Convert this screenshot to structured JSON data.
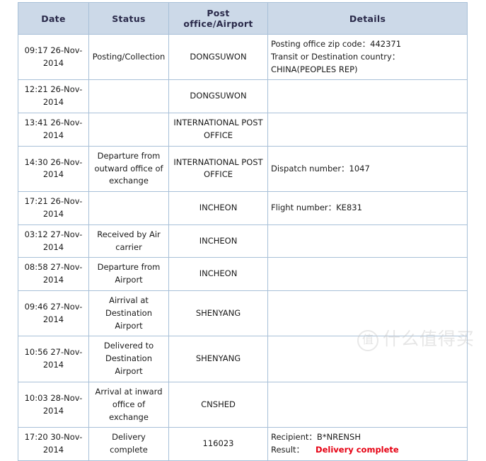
{
  "table": {
    "columns": [
      {
        "key": "date",
        "label": "Date"
      },
      {
        "key": "status",
        "label": "Status"
      },
      {
        "key": "office",
        "label": "Post office/Airport"
      },
      {
        "key": "detail",
        "label": "Details"
      }
    ],
    "rows": [
      {
        "date": "09:17 26-Nov-2014",
        "status": "Posting/Collection",
        "office": "DONGSUWON",
        "details": [
          "Posting office zip code：442371",
          "Transit or Destination country：",
          "CHINA(PEOPLES REP)"
        ]
      },
      {
        "date": "12:21 26-Nov-2014",
        "status": "",
        "office": "DONGSUWON",
        "details": []
      },
      {
        "date": "13:41 26-Nov-2014",
        "status": "",
        "office": "INTERNATIONAL POST OFFICE",
        "details": []
      },
      {
        "date": "14:30 26-Nov-2014",
        "status": "Departure from outward office of exchange",
        "office": "INTERNATIONAL POST OFFICE",
        "details": [
          "Dispatch number：1047"
        ]
      },
      {
        "date": "17:21 26-Nov-2014",
        "status": "",
        "office": "INCHEON",
        "details": [
          "Flight number：KE831"
        ]
      },
      {
        "date": "03:12 27-Nov-2014",
        "status": "Received by Air carrier",
        "office": "INCHEON",
        "details": []
      },
      {
        "date": "08:58 27-Nov-2014",
        "status": "Departure from Airport",
        "office": "INCHEON",
        "details": []
      },
      {
        "date": "09:46 27-Nov-2014",
        "status": "Airrival at Destination Airport",
        "office": "SHENYANG",
        "details": []
      },
      {
        "date": "10:56 27-Nov-2014",
        "status": "Delivered to Destination Airport",
        "office": "SHENYANG",
        "details": []
      },
      {
        "date": "10:03 28-Nov-2014",
        "status": "Arrival at inward office of exchange",
        "office": "CNSHED",
        "details": []
      },
      {
        "date": "17:20 30-Nov-2014",
        "status": "Delivery complete",
        "office": "116023",
        "details": [
          "Recipient：B*NRENSH"
        ],
        "result": {
          "label": "Result：",
          "value": "Delivery complete",
          "color": "#e60012"
        }
      }
    ]
  },
  "watermark": {
    "badge": "值",
    "text": "什么值得买"
  },
  "style": {
    "header_background": "#ccd9e8",
    "header_text": "#2a2a4a",
    "border": "#a8c0d8",
    "result_red": "#e60012"
  }
}
